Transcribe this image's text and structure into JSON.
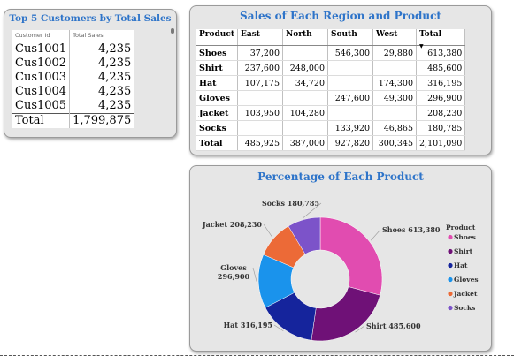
{
  "top_customers": {
    "title": "Top 5 Customers by Total Sales",
    "headers": [
      "Customer Id",
      "Total Sales"
    ],
    "rows": [
      {
        "id": "Cus1001",
        "sales": "4,235"
      },
      {
        "id": "Cus1002",
        "sales": "4,235"
      },
      {
        "id": "Cus1003",
        "sales": "4,235"
      },
      {
        "id": "Cus1004",
        "sales": "4,235"
      },
      {
        "id": "Cus1005",
        "sales": "4,235"
      }
    ],
    "total": {
      "label": "Total",
      "value": "1,799,875"
    }
  },
  "region_table": {
    "title": "Sales of Each Region and Product",
    "headers": [
      "Product",
      "East",
      "North",
      "South",
      "West",
      "Total"
    ],
    "rows": [
      {
        "product": "Shoes",
        "east": "37,200",
        "north": "",
        "south": "546,300",
        "west": "29,880",
        "total": "613,380"
      },
      {
        "product": "Shirt",
        "east": "237,600",
        "north": "248,000",
        "south": "",
        "west": "",
        "total": "485,600"
      },
      {
        "product": "Hat",
        "east": "107,175",
        "north": "34,720",
        "south": "",
        "west": "174,300",
        "total": "316,195"
      },
      {
        "product": "Gloves",
        "east": "",
        "north": "",
        "south": "247,600",
        "west": "49,300",
        "total": "296,900"
      },
      {
        "product": "Jacket",
        "east": "103,950",
        "north": "104,280",
        "south": "",
        "west": "",
        "total": "208,230"
      },
      {
        "product": "Socks",
        "east": "",
        "north": "",
        "south": "133,920",
        "west": "46,865",
        "total": "180,785"
      }
    ],
    "total_row": {
      "product": "Total",
      "east": "485,925",
      "north": "387,000",
      "south": "927,820",
      "west": "300,345",
      "total": "2,101,090"
    }
  },
  "chart_data": {
    "type": "pie",
    "title": "Percentage of Each Product",
    "legend_title": "Product",
    "legend_position": "right",
    "labels": [
      "Shoes",
      "Shirt",
      "Hat",
      "Gloves",
      "Jacket",
      "Socks"
    ],
    "values": [
      613380,
      485600,
      316195,
      296900,
      208230,
      180785
    ],
    "value_labels": [
      "613,380",
      "485,600",
      "316,195",
      "296,900",
      "208,230",
      "180,785"
    ],
    "colors": [
      "#e14cb0",
      "#6f1177",
      "#15249c",
      "#1a93ec",
      "#ec6a37",
      "#7c53c9"
    ]
  }
}
